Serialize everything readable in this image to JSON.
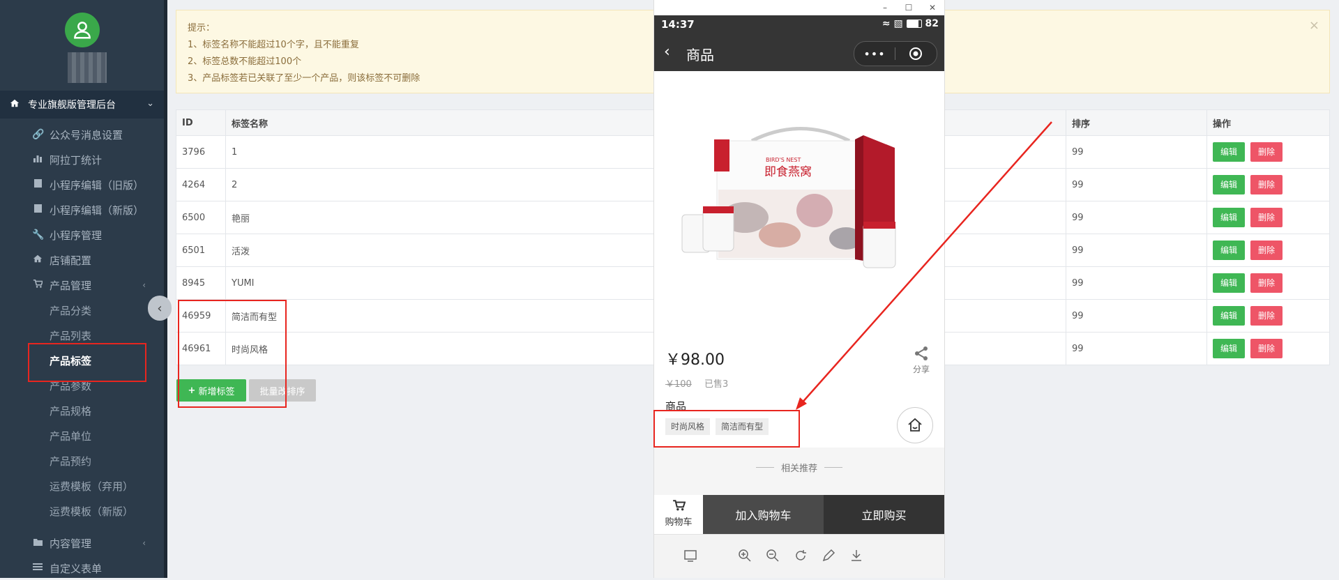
{
  "sidebar": {
    "menu_head": "专业旗舰版管理后台",
    "items": [
      {
        "label": "公众号消息设置",
        "icon": "link-icon"
      },
      {
        "label": "阿拉丁统计",
        "icon": "bar-chart-icon"
      },
      {
        "label": "小程序编辑（旧版）",
        "icon": "book-icon"
      },
      {
        "label": "小程序编辑（新版）",
        "icon": "book-icon"
      },
      {
        "label": "小程序管理",
        "icon": "wrench-icon"
      },
      {
        "label": "店铺配置",
        "icon": "home-icon"
      },
      {
        "label": "产品管理",
        "icon": "cart-icon"
      }
    ],
    "sub_items": [
      "产品分类",
      "产品列表",
      "产品标签",
      "产品参数",
      "产品规格",
      "产品单位",
      "产品预约",
      "运费模板（弃用）",
      "运费模板（新版）"
    ],
    "bottom_items": [
      {
        "label": "内容管理",
        "icon": "folder-icon"
      },
      {
        "label": "自定义表单",
        "icon": "list-icon"
      }
    ]
  },
  "notice": {
    "lines": [
      "提示：",
      "1、标签名称不能超过10个字，且不能重复",
      "2、标签总数不能超过100个",
      "3、产品标签若已关联了至少一个产品，则该标签不可删除"
    ],
    "close": "×"
  },
  "table": {
    "headers": [
      "ID",
      "标签名称",
      "排序",
      "操作"
    ],
    "rows": [
      {
        "id": "3796",
        "name": "1",
        "sort": "99"
      },
      {
        "id": "4264",
        "name": "2",
        "sort": "99"
      },
      {
        "id": "6500",
        "name": "艳丽",
        "sort": "99"
      },
      {
        "id": "6501",
        "name": "活泼",
        "sort": "99"
      },
      {
        "id": "8945",
        "name": "YUMI",
        "sort": "99"
      },
      {
        "id": "46959",
        "name": "简洁而有型",
        "sort": "99"
      },
      {
        "id": "46961",
        "name": "时尚风格",
        "sort": "99"
      }
    ],
    "edit_label": "编辑",
    "delete_label": "删除"
  },
  "actions": {
    "add_label": "新增标签",
    "batch_label": "批量改排序"
  },
  "phone": {
    "window_controls": [
      "–",
      "☐",
      "✕"
    ],
    "time": "14:37",
    "battery": "82",
    "nav_title": "商品",
    "product_image": {
      "brand_text": "BIRD'S NEST",
      "title_text": "即食燕窝"
    },
    "price": "￥98.00",
    "old_price": "￥100",
    "sold": "已售3",
    "share_label": "分享",
    "product_name": "商品",
    "tags": [
      "时尚风格",
      "简洁而有型"
    ],
    "related_label": "相关推荐",
    "cart_label": "购物车",
    "add_cart_label": "加入购物车",
    "buy_label": "立即购买"
  },
  "colors": {
    "accent_green": "#3fb754",
    "danger_red": "#ee5567",
    "annotation_red": "#e8251f",
    "sidebar_bg": "#2c3b4a"
  }
}
